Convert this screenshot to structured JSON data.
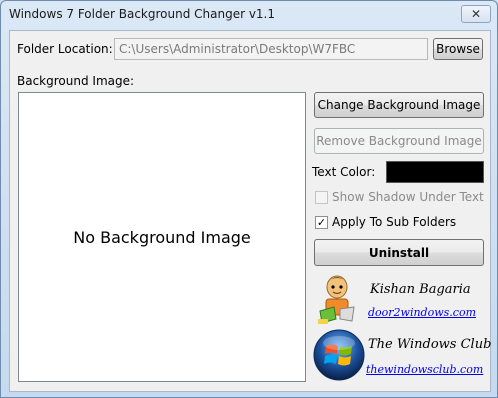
{
  "window": {
    "title": "Windows 7 Folder Background Changer v1.1",
    "close_glyph": "✕"
  },
  "folder": {
    "label": "Folder Location:",
    "value": "C:\\Users\\Administrator\\Desktop\\W7FBC",
    "browse_label": "Browse"
  },
  "background": {
    "label": "Background Image:",
    "preview_text": "No Background Image"
  },
  "actions": {
    "change_label": "Change Background Image",
    "remove_label": "Remove Background Image",
    "uninstall_label": "Uninstall"
  },
  "text_color": {
    "label": "Text Color:",
    "value": "#000000"
  },
  "options": {
    "show_shadow": {
      "label": "Show Shadow Under Text",
      "checked": false,
      "enabled": false
    },
    "apply_subfolders": {
      "label": "Apply To Sub Folders",
      "checked": true,
      "enabled": true,
      "check_glyph": "✓"
    }
  },
  "credits": {
    "author": {
      "name": "Kishan Bagaria",
      "link": "door2windows.com",
      "icon": "person-with-laptop-icon"
    },
    "club": {
      "name": "The Windows Club",
      "link": "thewindowsclub.com",
      "icon": "windows-logo-icon"
    }
  }
}
